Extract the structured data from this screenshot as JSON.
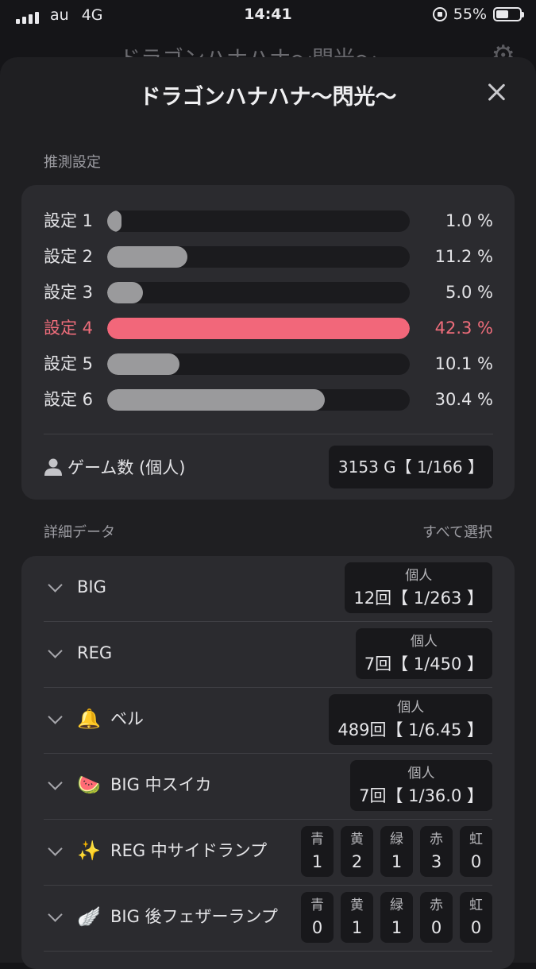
{
  "status_bar": {
    "carrier": "au",
    "network": "4G",
    "time": "14:41",
    "battery": "55%",
    "battery_level": 0.55
  },
  "background_title": "ドラゴンハナハナ〜閃光〜",
  "sheet": {
    "title": "ドラゴンハナハナ〜閃光〜",
    "estimate_label": "推測設定",
    "settings": [
      {
        "label": "設定 1",
        "pct_text": "1.0 %",
        "value": 1.0,
        "highlight": false
      },
      {
        "label": "設定 2",
        "pct_text": "11.2 %",
        "value": 11.2,
        "highlight": false
      },
      {
        "label": "設定 3",
        "pct_text": "5.0 %",
        "value": 5.0,
        "highlight": false
      },
      {
        "label": "設定 4",
        "pct_text": "42.3 %",
        "value": 42.3,
        "highlight": true
      },
      {
        "label": "設定 5",
        "pct_text": "10.1 %",
        "value": 10.1,
        "highlight": false
      },
      {
        "label": "設定 6",
        "pct_text": "30.4 %",
        "value": 30.4,
        "highlight": false
      }
    ],
    "games": {
      "label": "ゲーム数 (個人)",
      "value": "3153 G【 1/166 】"
    },
    "detail_label": "詳細データ",
    "select_all": "すべて選択",
    "details": [
      {
        "name": "BIG",
        "icon": "",
        "caption": "個人",
        "value": "12回【 1/263 】"
      },
      {
        "name": "REG",
        "icon": "",
        "caption": "個人",
        "value": "7回【 1/450 】"
      },
      {
        "name": "ベル",
        "icon": "🔔",
        "caption": "個人",
        "value": "489回【 1/6.45 】"
      },
      {
        "name": "BIG 中スイカ",
        "icon": "🍉",
        "caption": "個人",
        "value": "7回【 1/36.0 】"
      }
    ],
    "lamp_rows": [
      {
        "name": "REG 中サイドランプ",
        "icon": "✨",
        "lamps": [
          {
            "c": "青",
            "n": "1"
          },
          {
            "c": "黄",
            "n": "2"
          },
          {
            "c": "緑",
            "n": "1"
          },
          {
            "c": "赤",
            "n": "3"
          },
          {
            "c": "虹",
            "n": "0"
          }
        ]
      },
      {
        "name": "BIG 後フェザーランプ",
        "icon": "🪽",
        "lamps": [
          {
            "c": "青",
            "n": "0"
          },
          {
            "c": "黄",
            "n": "1"
          },
          {
            "c": "緑",
            "n": "1"
          },
          {
            "c": "赤",
            "n": "0"
          },
          {
            "c": "虹",
            "n": "0"
          }
        ]
      }
    ]
  },
  "colors": {
    "highlight": "#f2677a",
    "bar": "#9a9a9c",
    "card": "#2b2b2f"
  }
}
